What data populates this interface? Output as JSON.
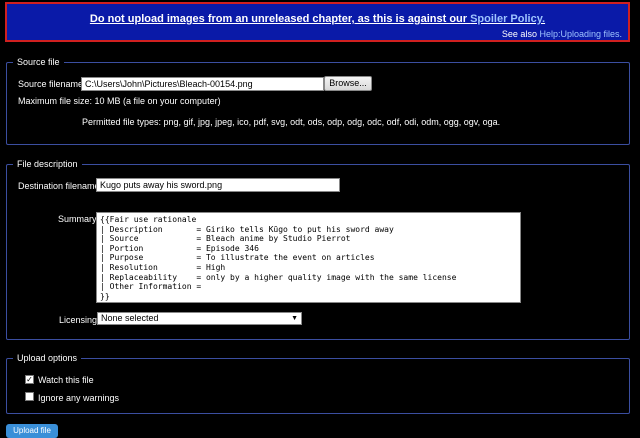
{
  "notice": {
    "main_prefix": "Do not upload images from an unreleased chapter, as this is against our ",
    "main_link": "Spoiler Policy.",
    "sub_prefix": "See also ",
    "sub_link": "Help:Uploading files."
  },
  "source_file": {
    "legend": "Source file",
    "filename_label": "Source filename:",
    "filename_value": "C:\\Users\\John\\Pictures\\Bleach-00154.png",
    "browse_label": "Browse...",
    "max_size_text": "Maximum file size: 10 MB (a file on your computer)",
    "permitted_text": "Permitted file types: png, gif, jpg, jpeg, ico, pdf, svg, odt, ods, odp, odg, odc, odf, odi, odm, ogg, ogv, oga."
  },
  "file_description": {
    "legend": "File description",
    "destination_label": "Destination filename:",
    "destination_value": "Kugo puts away his sword.png",
    "summary_label": "Summary:",
    "summary_value": "{{Fair use rationale\n| Description       = Giriko tells Kūgo to put his sword away\n| Source            = Bleach anime by Studio Pierrot\n| Portion           = Episode 346\n| Purpose           = To illustrate the event on articles\n| Resolution        = High\n| Replaceability    = only by a higher quality image with the same license\n| Other Information =\n}}",
    "licensing_label": "Licensing",
    "licensing_value": "None selected"
  },
  "upload_options": {
    "legend": "Upload options",
    "watch_label": "Watch this file",
    "watch_checked": true,
    "ignore_label": "Ignore any warnings",
    "ignore_checked": false
  },
  "upload_button_label": "Upload file"
}
